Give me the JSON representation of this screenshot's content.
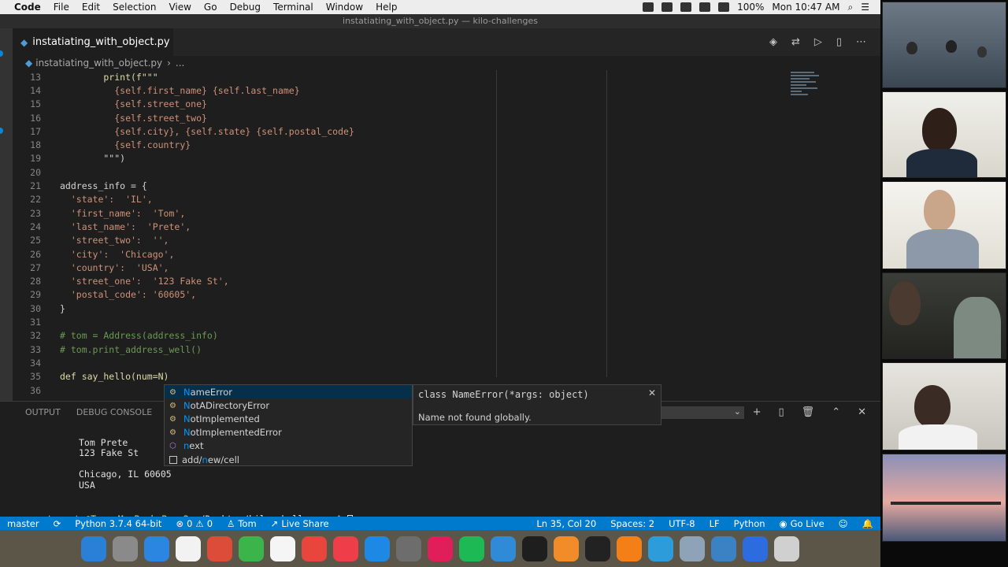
{
  "menubar": {
    "app_name": "Code",
    "items": [
      "File",
      "Edit",
      "Selection",
      "View",
      "Go",
      "Debug",
      "Terminal",
      "Window",
      "Help"
    ],
    "battery": "100%",
    "clock": "Mon 10:47 AM"
  },
  "window_title": "instatiating_with_object.py — kilo-challenges",
  "tab": {
    "filename": "instatiating_with_object.py"
  },
  "breadcrumb": {
    "file": "instatiating_with_object.py",
    "more": "..."
  },
  "code_lines": [
    {
      "n": "13",
      "t": "        print(f\"\"\""
    },
    {
      "n": "14",
      "t": "          {self.first_name} {self.last_name}"
    },
    {
      "n": "15",
      "t": "          {self.street_one}"
    },
    {
      "n": "16",
      "t": "          {self.street_two}"
    },
    {
      "n": "17",
      "t": "          {self.city}, {self.state} {self.postal_code}"
    },
    {
      "n": "18",
      "t": "          {self.country}"
    },
    {
      "n": "19",
      "t": "        \"\"\")"
    },
    {
      "n": "20",
      "t": ""
    },
    {
      "n": "21",
      "t": "address_info = {"
    },
    {
      "n": "22",
      "t": "  'state':  'IL',"
    },
    {
      "n": "23",
      "t": "  'first_name':  'Tom',"
    },
    {
      "n": "24",
      "t": "  'last_name':  'Prete',"
    },
    {
      "n": "25",
      "t": "  'street_two':  '',"
    },
    {
      "n": "26",
      "t": "  'city':  'Chicago',"
    },
    {
      "n": "27",
      "t": "  'country':  'USA',"
    },
    {
      "n": "28",
      "t": "  'street_one':  '123 Fake St',"
    },
    {
      "n": "29",
      "t": "  'postal_code': '60605',"
    },
    {
      "n": "30",
      "t": "}"
    },
    {
      "n": "31",
      "t": ""
    },
    {
      "n": "32",
      "t": "# tom = Address(address_info)"
    },
    {
      "n": "33",
      "t": "# tom.print_address_well()"
    },
    {
      "n": "34",
      "t": ""
    },
    {
      "n": "35",
      "t": "def say_hello(num=N)"
    },
    {
      "n": "36",
      "t": ""
    }
  ],
  "panel": {
    "tabs": [
      "OUTPUT",
      "DEBUG CONSOLE",
      "T"
    ],
    "terminal_lines": [
      "Tom Prete",
      "123 Fake St",
      "",
      "Chicago, IL 60605",
      "USA"
    ],
    "prompt_user": "taprete@Toms-MacBook-Pro-2",
    "prompt_path": ":~/Desktop/kilo-challenges $ "
  },
  "suggest": {
    "items": [
      {
        "pre": "",
        "hl": "N",
        "post": "ameError",
        "kind": "class"
      },
      {
        "pre": "",
        "hl": "N",
        "post": "otADirectoryError",
        "kind": "class"
      },
      {
        "pre": "",
        "hl": "N",
        "post": "otImplemented",
        "kind": "class"
      },
      {
        "pre": "",
        "hl": "N",
        "post": "otImplementedError",
        "kind": "class"
      },
      {
        "pre": "",
        "hl": "n",
        "post": "ext",
        "kind": "function"
      },
      {
        "pre": "add/",
        "hl": "n",
        "post": "ew/cell",
        "kind": "snippet"
      }
    ],
    "detail_signature": "class NameError(*args: object)",
    "detail_doc": "Name not found globally."
  },
  "status": {
    "branch": "master",
    "interpreter": "Python 3.7.4 64-bit",
    "errors": "0",
    "warnings": "0",
    "user": "Tom",
    "live_share": "Live Share",
    "position": "Ln 35, Col 20",
    "spaces": "Spaces: 2",
    "encoding": "UTF-8",
    "eol": "LF",
    "language": "Python",
    "go_live": "Go Live"
  },
  "dock_colors": [
    "#2a7fd6",
    "#8a8a8a",
    "#2a86e0",
    "#f2f2f2",
    "#dd4b39",
    "#3bb54a",
    "#f5f5f5",
    "#e8453c",
    "#ef3e4a",
    "#1e88e5",
    "#6d6d6d",
    "#e01e5a",
    "#1db954",
    "#2f8ad8",
    "#1e1e1e",
    "#f28c28",
    "#222222",
    "#f57f17",
    "#2d9cdb",
    "#8fa3b8",
    "#3b82c4",
    "#2d6cdf",
    "#d0d0d0"
  ]
}
